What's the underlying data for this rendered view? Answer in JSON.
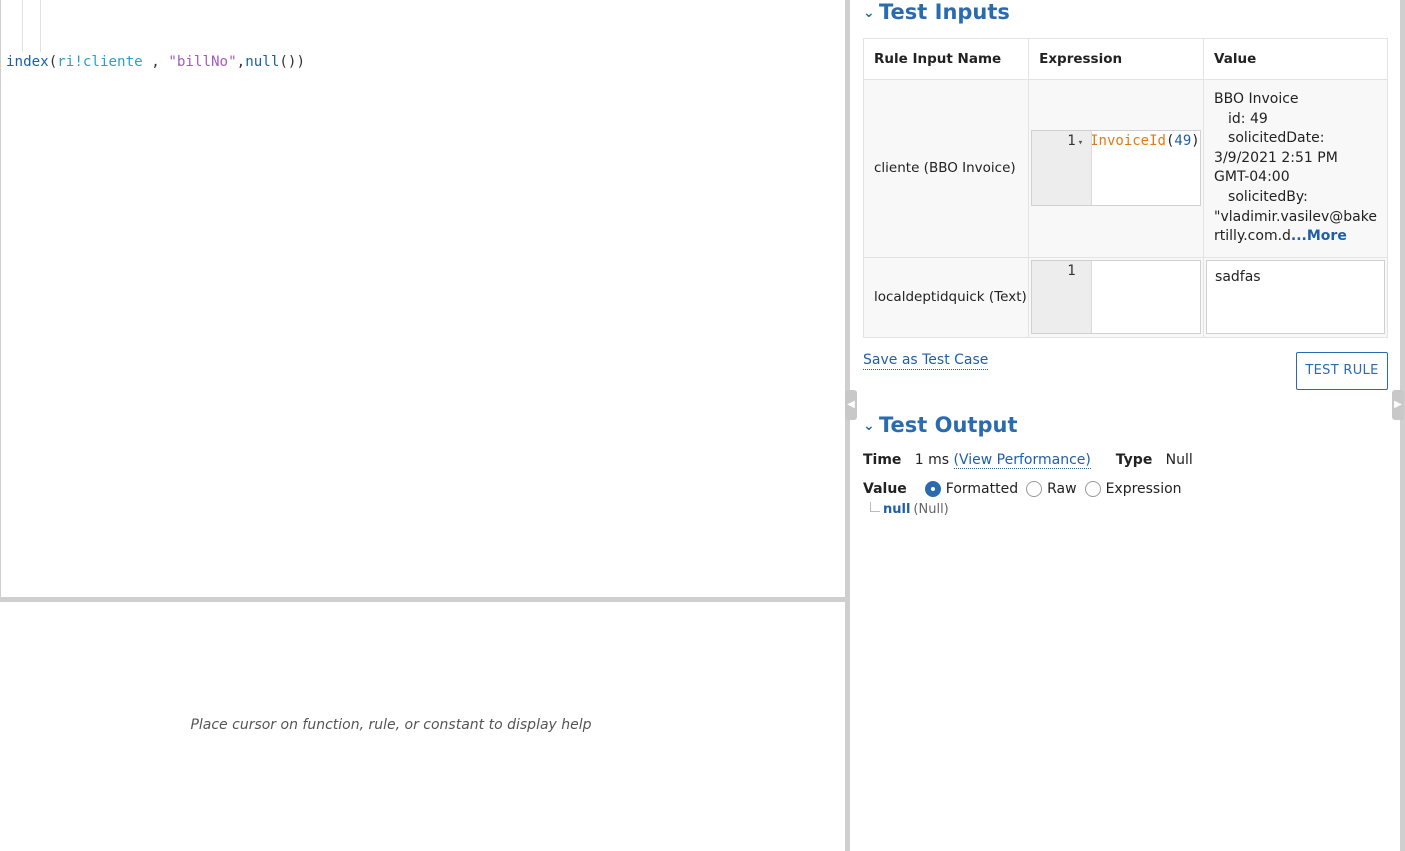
{
  "editor": {
    "code": {
      "fn_index": "index",
      "open": "(",
      "var": "ri!cliente",
      "sep1": " , ",
      "str": "\"billNo\"",
      "comma": ",",
      "fn_null": "null",
      "close": "())"
    }
  },
  "help": {
    "text": "Place cursor on function, rule, or constant to display help"
  },
  "test_inputs": {
    "title": "Test Inputs",
    "headers": [
      "Rule Input Name",
      "Expression",
      "Value"
    ],
    "rows": [
      {
        "name": "cliente (BBO Invoice)",
        "line": "1",
        "expr_fn": "InvoiceId",
        "expr_open": "(",
        "expr_num": "49",
        "expr_close": ")",
        "value_lines": [
          "BBO Invoice",
          "id: 49",
          "solicitedDate:",
          "3/9/2021 2:51 PM",
          "GMT-04:00",
          "solicitedBy:",
          "\"vladimir.vasilev@bake",
          "rtilly.com.d"
        ],
        "more": "...More"
      },
      {
        "name": "localdeptidquick (Text)",
        "line": "1",
        "value": "sadfas"
      }
    ],
    "save_link": "Save as Test Case",
    "test_button": "TEST RULE"
  },
  "test_output": {
    "title": "Test Output",
    "time_label": "Time",
    "time_value": "1 ms",
    "view_perf": "(View Performance)",
    "type_label": "Type",
    "type_value": "Null",
    "value_label": "Value",
    "options": [
      "Formatted",
      "Raw",
      "Expression"
    ],
    "selected": "Formatted",
    "result": "null",
    "result_type": "(Null)"
  },
  "colors": {
    "accent": "#2a6bb0",
    "link": "#1f5fa8",
    "function_token": "#1a5fa8",
    "variable_token": "#2aa0c9",
    "string_token": "#a35bc2",
    "rule_token": "#e07a18"
  }
}
